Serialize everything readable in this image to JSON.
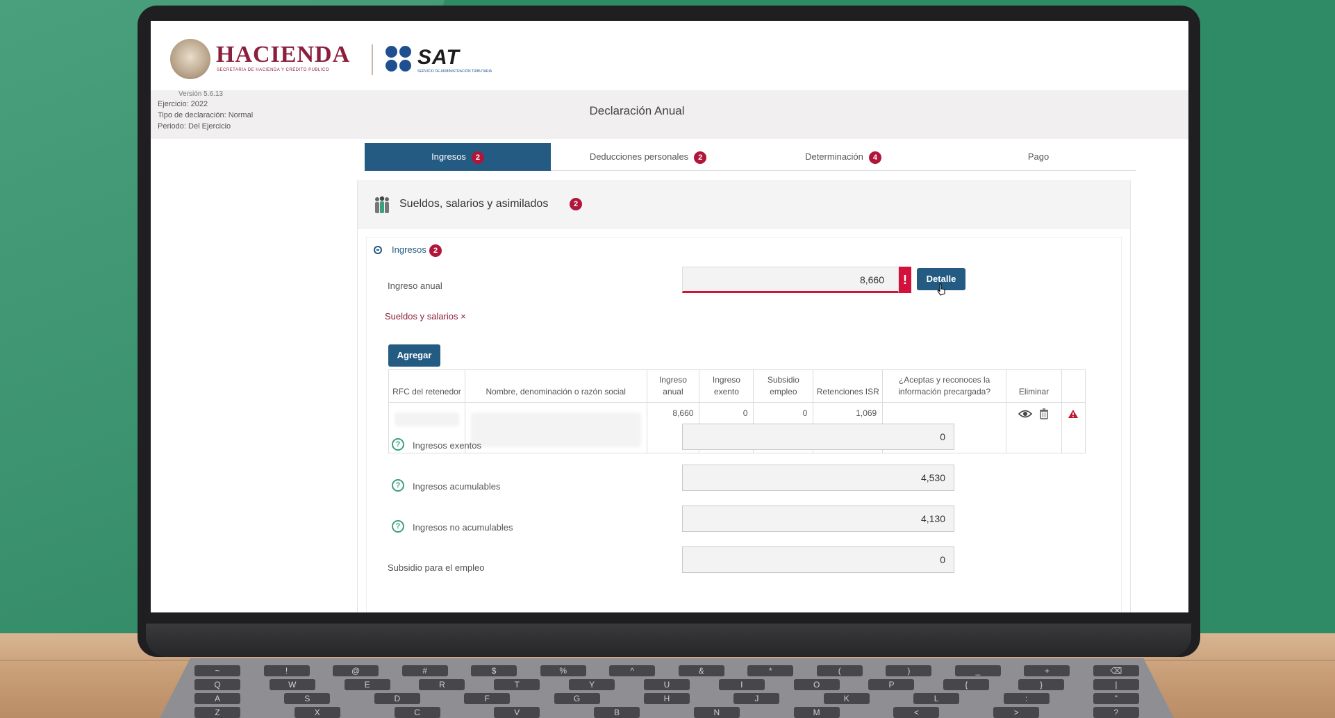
{
  "header": {
    "hacienda_title": "HACIENDA",
    "hacienda_subtitle": "SECRETARÍA DE HACIENDA Y CRÉDITO PÚBLICO",
    "sat_title": "SAT",
    "sat_subtitle": "SERVICIO DE ADMINISTRACIÓN TRIBUTARIA"
  },
  "meta": {
    "version": "Versión 5.6.13",
    "ejercicio": "Ejercicio: 2022",
    "tipo": "Tipo de declaración: Normal",
    "periodo": "Periodo: Del Ejercicio"
  },
  "page_title": "Declaración Anual",
  "tabs": [
    {
      "label": "Ingresos",
      "badge": "2",
      "active": true
    },
    {
      "label": "Deducciones personales",
      "badge": "2",
      "active": false
    },
    {
      "label": "Determinación",
      "badge": "4",
      "active": false
    },
    {
      "label": "Pago",
      "badge": "",
      "active": false
    }
  ],
  "section": {
    "title": "Sueldos, salarios y asimilados",
    "badge": "2",
    "sub_title": "Ingresos",
    "sub_badge": "2"
  },
  "ingreso_anual": {
    "label": "Ingreso anual",
    "value": "8,660",
    "error_mark": "!",
    "detail_button": "Detalle"
  },
  "sueldos_link": "Sueldos y salarios ×",
  "add_button": "Agregar",
  "table": {
    "headers": [
      "RFC del retenedor",
      "Nombre, denominación o razón social",
      "Ingreso anual",
      "Ingreso exento",
      "Subsidio empleo",
      "Retenciones ISR",
      "¿Aceptas y reconoces la información precargada?",
      "Eliminar",
      ""
    ],
    "row": {
      "rfc": "",
      "nombre": "",
      "ingreso_anual": "8,660",
      "ingreso_exento": "0",
      "subsidio_empleo": "0",
      "retenciones_isr": "1,069",
      "acepta": ""
    }
  },
  "totals": [
    {
      "label": "Ingresos exentos",
      "value": "0"
    },
    {
      "label": "Ingresos acumulables",
      "value": "4,530"
    },
    {
      "label": "Ingresos no acumulables",
      "value": "4,130"
    },
    {
      "label": "Subsidio para el empleo",
      "value": "0"
    }
  ],
  "colors": {
    "primary_blue": "#235b82",
    "badge_red": "#b0163a",
    "error_red": "#d3123c",
    "brand_maroon": "#8c1f3c",
    "help_green": "#3aa07f"
  },
  "keyboard_rows": [
    [
      "~",
      "!",
      "@",
      "#",
      "$",
      "%",
      "^",
      "&",
      "*",
      "(",
      ")",
      "_",
      "+",
      "⌫"
    ],
    [
      "Q",
      "W",
      "E",
      "R",
      "T",
      "Y",
      "U",
      "I",
      "O",
      "P",
      "{",
      "}",
      "|"
    ],
    [
      "A",
      "S",
      "D",
      "F",
      "G",
      "H",
      "J",
      "K",
      "L",
      ":",
      "\""
    ],
    [
      "Z",
      "X",
      "C",
      "V",
      "B",
      "N",
      "M",
      "<",
      ">",
      "?"
    ]
  ]
}
